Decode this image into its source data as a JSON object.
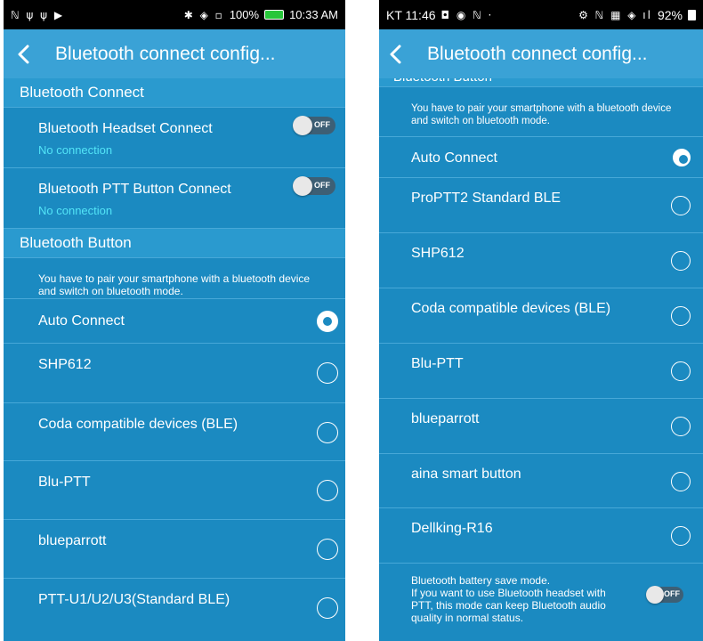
{
  "left": {
    "status": {
      "left_icons": "ℕ ψ ψ ▶",
      "right_icons": "✱ ◈ ▫",
      "battery": "100%",
      "time": "10:33 AM"
    },
    "appbar": {
      "title": "Bluetooth connect config..."
    },
    "bluetooth_connect": {
      "header": "Bluetooth Connect",
      "items": [
        {
          "label": "Bluetooth Headset Connect",
          "status": "No connection",
          "toggle": "OFF"
        },
        {
          "label": "Bluetooth PTT Button Connect",
          "status": "No connection",
          "toggle": "OFF"
        }
      ]
    },
    "bluetooth_button": {
      "header": "Bluetooth Button",
      "info": "You have to pair your smartphone with a bluetooth device and switch on bluetooth mode.",
      "options": [
        {
          "label": "Auto Connect",
          "selected": true
        },
        {
          "label": "SHP612",
          "selected": false
        },
        {
          "label": "Coda compatible devices (BLE)",
          "selected": false
        },
        {
          "label": "Blu-PTT",
          "selected": false
        },
        {
          "label": "blueparrott",
          "selected": false
        },
        {
          "label": "PTT-U1/U2/U3(Standard BLE)",
          "selected": false
        }
      ]
    }
  },
  "right": {
    "status": {
      "carrier_time": "KT 11:46",
      "left_icons": "◘ ◉ ℕ ·",
      "right_icons": "⚙ ℕ ▦ ◈ ıl",
      "battery": "92%"
    },
    "appbar": {
      "title": "Bluetooth connect config..."
    },
    "bluetooth_button": {
      "header": "Bluetooth Button",
      "info": "You have to pair your smartphone with a bluetooth device and switch on bluetooth mode.",
      "options": [
        {
          "label": "Auto Connect",
          "selected": true
        },
        {
          "label": "ProPTT2 Standard BLE",
          "selected": false
        },
        {
          "label": "SHP612",
          "selected": false
        },
        {
          "label": "Coda compatible devices (BLE)",
          "selected": false
        },
        {
          "label": "Blu-PTT",
          "selected": false
        },
        {
          "label": "blueparrott",
          "selected": false
        },
        {
          "label": "aina smart button",
          "selected": false
        },
        {
          "label": "Dellking-R16",
          "selected": false
        }
      ]
    },
    "battery_save": {
      "text": "Bluetooth battery save mode.\nIf you want to use Bluetooth headset with PTT, this mode can keep Bluetooth audio quality in normal status.",
      "toggle": "OFF"
    }
  }
}
